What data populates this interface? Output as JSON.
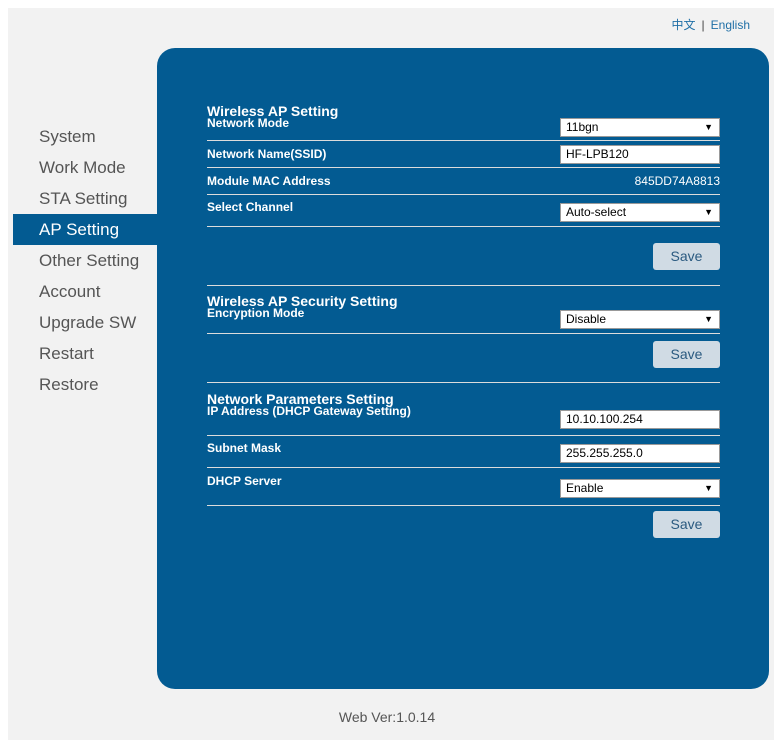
{
  "language": {
    "chinese": "中文",
    "separator": "|",
    "english": "English"
  },
  "sidebar": {
    "items": [
      {
        "label": "System"
      },
      {
        "label": "Work Mode"
      },
      {
        "label": "STA Setting"
      },
      {
        "label": "AP Setting",
        "active": true
      },
      {
        "label": "Other Setting"
      },
      {
        "label": "Account"
      },
      {
        "label": "Upgrade SW"
      },
      {
        "label": "Restart"
      },
      {
        "label": "Restore"
      }
    ]
  },
  "ap_setting": {
    "title": "Wireless AP Setting",
    "network_mode": {
      "label": "Network Mode",
      "value": "11bgn"
    },
    "ssid": {
      "label": "Network Name(SSID)",
      "value": "HF-LPB120"
    },
    "mac": {
      "label": "Module MAC Address",
      "value": "845DD74A8813"
    },
    "channel": {
      "label": "Select Channel",
      "value": "Auto-select"
    },
    "save_label": "Save"
  },
  "security": {
    "title": "Wireless AP Security Setting",
    "encryption": {
      "label": "Encryption Mode",
      "value": "Disable"
    },
    "save_label": "Save"
  },
  "network": {
    "title": "Network Parameters Setting",
    "ip": {
      "label": "IP Address (DHCP Gateway Setting)",
      "value": "10.10.100.254"
    },
    "subnet": {
      "label": "Subnet Mask",
      "value": "255.255.255.0"
    },
    "dhcp": {
      "label": "DHCP Server",
      "value": "Enable"
    },
    "save_label": "Save"
  },
  "footer": {
    "version": "Web Ver:1.0.14"
  },
  "colors": {
    "panel": "#035b92",
    "page_background": "#f2f2f2",
    "button": "#d0dbe4"
  }
}
